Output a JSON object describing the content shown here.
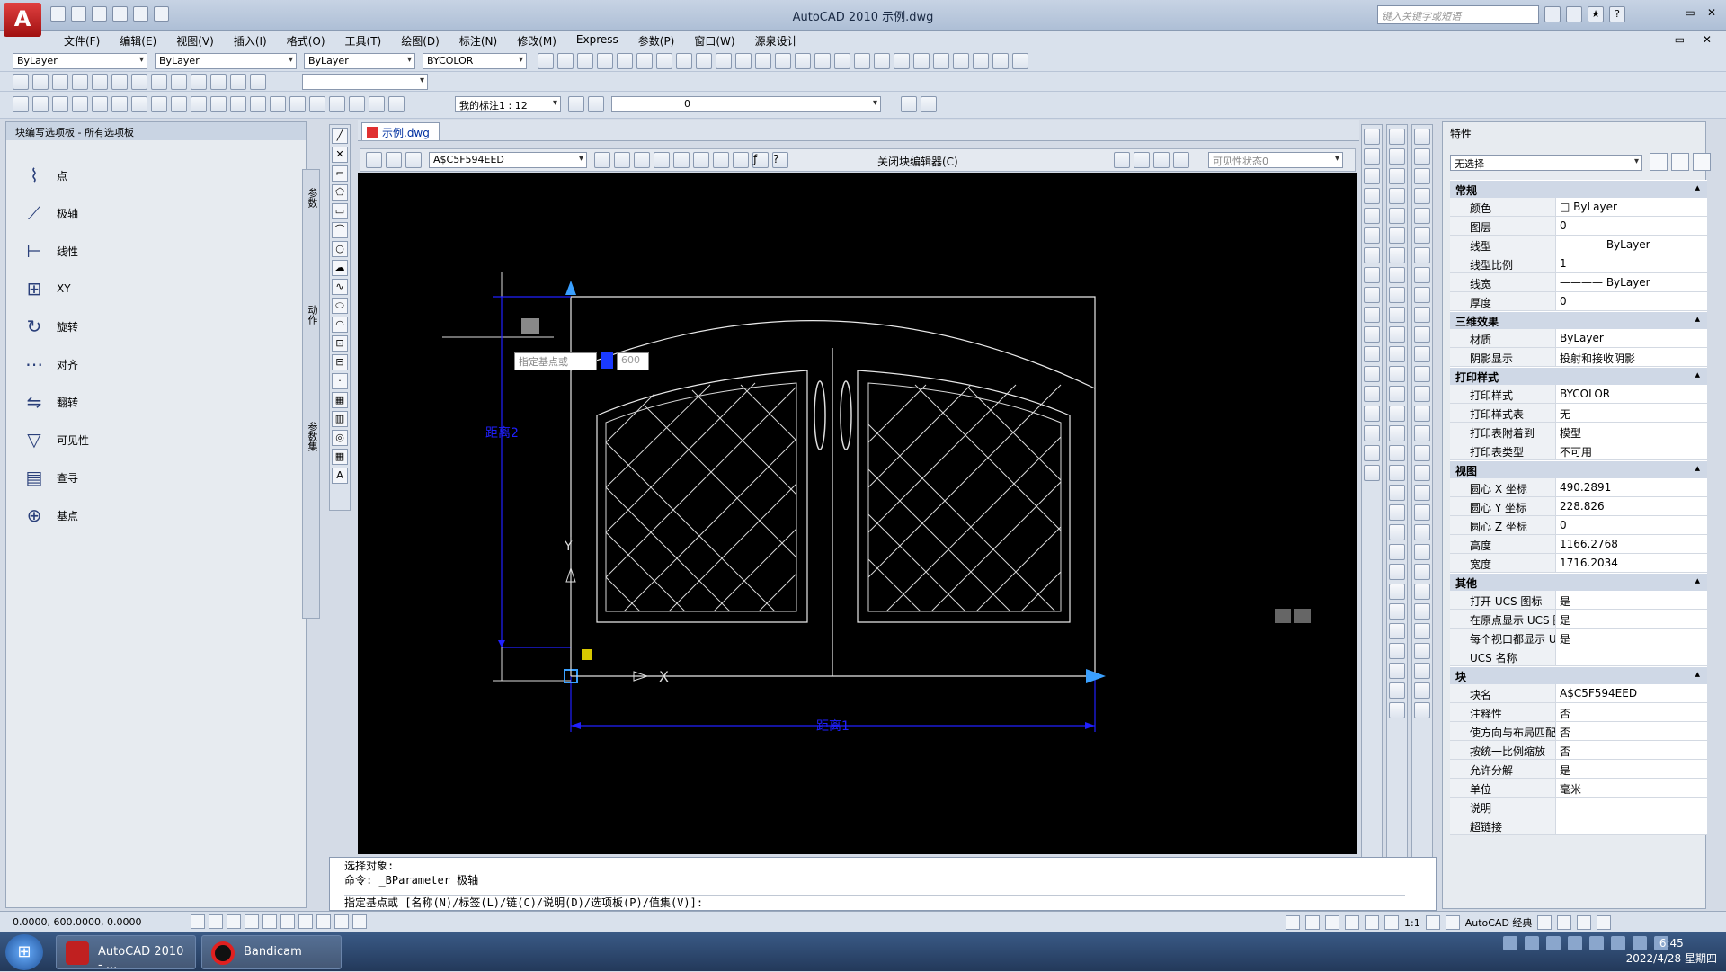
{
  "app": {
    "title": "AutoCAD 2010    示例.dwg",
    "logo": "A",
    "search_placeholder": "键入关键字或短语",
    "window_controls": [
      "—",
      "▭",
      "✕"
    ]
  },
  "menubar": {
    "items": [
      "文件(F)",
      "编辑(E)",
      "视图(V)",
      "插入(I)",
      "格式(O)",
      "工具(T)",
      "绘图(D)",
      "标注(N)",
      "修改(M)",
      "Express",
      "参数(P)",
      "窗口(W)",
      "源泉设计"
    ],
    "controls": "— ▭ ✕"
  },
  "toolbar": {
    "layer_combo": "ByLayer",
    "linetype_combo": "ByLayer",
    "lineweight_combo": "ByLayer",
    "plotstyle_combo": "BYCOLOR",
    "annot_scale": "我的标注1 : 12",
    "layer_current": "0"
  },
  "palette": {
    "title": "块编写选项板 - 所有选项板",
    "items": [
      {
        "label": "点",
        "icon": "point-param-icon"
      },
      {
        "label": "极轴",
        "icon": "polar-param-icon"
      },
      {
        "label": "线性",
        "icon": "linear-param-icon"
      },
      {
        "label": "XY",
        "icon": "xy-param-icon"
      },
      {
        "label": "旋转",
        "icon": "rotation-param-icon"
      },
      {
        "label": "对齐",
        "icon": "alignment-param-icon"
      },
      {
        "label": "翻转",
        "icon": "flip-param-icon"
      },
      {
        "label": "可见性",
        "icon": "visibility-param-icon"
      },
      {
        "label": "查寻",
        "icon": "lookup-param-icon"
      },
      {
        "label": "基点",
        "icon": "basepoint-param-icon"
      }
    ],
    "side_tabs": [
      "参数",
      "动作",
      "参数集"
    ]
  },
  "document": {
    "tab": "示例.dwg"
  },
  "block_editor": {
    "block_name": "A$C5F594EED",
    "close_label": "关闭块编辑器(C)",
    "visibility_state": "可见性状态0"
  },
  "canvas": {
    "prompt_label": "指定基点或",
    "prompt_value": "600",
    "dim1_label": "距离1",
    "dim2_label": "距离2",
    "axis_y": "Y",
    "axis_x": "X"
  },
  "command": {
    "lines": [
      "选择对象:",
      "命令: _BParameter 极轴"
    ],
    "prompt": "指定基点或 [名称(N)/标签(L)/链(C)/说明(D)/选项板(P)/值集(V)]:"
  },
  "properties": {
    "title": "特性",
    "selection": "无选择",
    "sections": [
      {
        "name": "常规",
        "rows": [
          [
            "颜色",
            "□ ByLayer"
          ],
          [
            "图层",
            "0"
          ],
          [
            "线型",
            "———— ByLayer"
          ],
          [
            "线型比例",
            "1"
          ],
          [
            "线宽",
            "———— ByLayer"
          ],
          [
            "厚度",
            "0"
          ]
        ]
      },
      {
        "name": "三维效果",
        "rows": [
          [
            "材质",
            "ByLayer"
          ],
          [
            "阴影显示",
            "投射和接收阴影"
          ]
        ]
      },
      {
        "name": "打印样式",
        "rows": [
          [
            "打印样式",
            "BYCOLOR"
          ],
          [
            "打印样式表",
            "无"
          ],
          [
            "打印表附着到",
            "模型"
          ],
          [
            "打印表类型",
            "不可用"
          ]
        ]
      },
      {
        "name": "视图",
        "rows": [
          [
            "圆心 X 坐标",
            "490.2891"
          ],
          [
            "圆心 Y 坐标",
            "228.826"
          ],
          [
            "圆心 Z 坐标",
            "0"
          ],
          [
            "高度",
            "1166.2768"
          ],
          [
            "宽度",
            "1716.2034"
          ]
        ]
      },
      {
        "name": "其他",
        "rows": [
          [
            "打开 UCS 图标",
            "是"
          ],
          [
            "在原点显示 UCS 图标",
            "是"
          ],
          [
            "每个视口都显示 UCS",
            "是"
          ],
          [
            "UCS 名称",
            ""
          ]
        ]
      },
      {
        "name": "块",
        "rows": [
          [
            "块名",
            "A$C5F594EED"
          ],
          [
            "注释性",
            "否"
          ],
          [
            "使方向与布局匹配",
            "否"
          ],
          [
            "按统一比例缩放",
            "否"
          ],
          [
            "允许分解",
            "是"
          ],
          [
            "单位",
            "毫米"
          ],
          [
            "说明",
            ""
          ],
          [
            "超链接",
            ""
          ]
        ]
      }
    ]
  },
  "statusbar": {
    "coords": "0.0000,  600.0000,  0.0000",
    "scale": "1:1",
    "workspace": "AutoCAD 经典"
  },
  "taskbar": {
    "tasks": [
      "AutoCAD 2010 - ...",
      "Bandicam"
    ],
    "time": "6:45",
    "date": "2022/4/28 星期四"
  },
  "colors": {
    "canvas": "#000000",
    "dim_blue": "#2020ff",
    "grip_blue": "#3aa0ff"
  }
}
